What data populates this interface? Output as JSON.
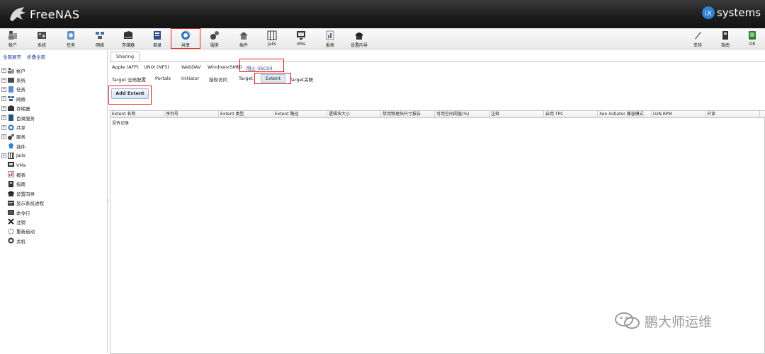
{
  "app": {
    "brand": "FreeNAS",
    "vendor": "systems",
    "vendor_prefix": "iX"
  },
  "toolbar": {
    "items": [
      {
        "label": "帐户",
        "icon": "account-icon"
      },
      {
        "label": "系统",
        "icon": "system-icon"
      },
      {
        "label": "任务",
        "icon": "tasks-icon"
      },
      {
        "label": "网络",
        "icon": "network-icon"
      },
      {
        "label": "存储器",
        "icon": "storage-icon"
      },
      {
        "label": "目录",
        "icon": "directory-icon"
      },
      {
        "label": "共享",
        "icon": "sharing-icon"
      },
      {
        "label": "服务",
        "icon": "services-icon"
      },
      {
        "label": "插件",
        "icon": "plugins-icon"
      },
      {
        "label": "Jails",
        "icon": "jails-icon"
      },
      {
        "label": "VMs",
        "icon": "vms-icon"
      },
      {
        "label": "报表",
        "icon": "reporting-icon"
      },
      {
        "label": "设置向导",
        "icon": "wizard-icon"
      }
    ],
    "right_items": [
      {
        "label": "支持",
        "icon": "support-icon"
      },
      {
        "label": "指南",
        "icon": "guide-icon"
      },
      {
        "label": "OK",
        "icon": "alert-ok-icon"
      }
    ]
  },
  "left": {
    "expand_all": "全部展开",
    "collapse_all": "折叠全部",
    "tree": [
      {
        "label": "帐户",
        "expandable": true,
        "icon": "account-icon"
      },
      {
        "label": "系统",
        "expandable": true,
        "icon": "system-icon"
      },
      {
        "label": "任务",
        "expandable": true,
        "icon": "tasks-icon"
      },
      {
        "label": "网络",
        "expandable": true,
        "icon": "network-icon"
      },
      {
        "label": "存储器",
        "expandable": true,
        "icon": "storage-icon"
      },
      {
        "label": "目录服务",
        "expandable": true,
        "icon": "directory-icon"
      },
      {
        "label": "共享",
        "expandable": true,
        "icon": "sharing-icon"
      },
      {
        "label": "服务",
        "expandable": true,
        "icon": "services-icon"
      },
      {
        "label": "插件",
        "expandable": false,
        "icon": "plugins-icon"
      },
      {
        "label": "Jails",
        "expandable": true,
        "icon": "jails-icon"
      },
      {
        "label": "VMs",
        "expandable": false,
        "icon": "vms-icon"
      },
      {
        "label": "报表",
        "expandable": false,
        "icon": "reporting-icon"
      },
      {
        "label": "指南",
        "expandable": false,
        "icon": "guide-icon"
      },
      {
        "label": "设置向导",
        "expandable": false,
        "icon": "wizard-icon"
      },
      {
        "label": "显示系统进程",
        "expandable": false,
        "icon": "processes-icon"
      },
      {
        "label": "命令行",
        "expandable": false,
        "icon": "shell-icon"
      },
      {
        "label": "注销",
        "expandable": false,
        "icon": "logout-icon"
      },
      {
        "label": "重新启动",
        "expandable": false,
        "icon": "reboot-icon"
      },
      {
        "label": "关机",
        "expandable": false,
        "icon": "shutdown-icon"
      }
    ]
  },
  "main": {
    "tab": "Sharing",
    "share_tabs": [
      "Apple (AFP)",
      "UNIX (NFS)",
      "WebDAV",
      "Windows(SMB)",
      "阻止 (iSCSI)"
    ],
    "iscsi_tabs": [
      "Target 全局配置",
      "Portals",
      "Initiator",
      "授权访问",
      "Target",
      "Extent",
      "Target关联"
    ],
    "add_button": "Add Extent",
    "columns": [
      "Extent 名称",
      "序列号",
      "Extent 类型",
      "Extent 路径",
      "逻辑块大小",
      "禁用物理块尺寸报告",
      "可用空间阈值(%)",
      "注释",
      "启用 TPC",
      "Xen Initiator 兼容模式",
      "LUN RPM",
      "只读"
    ],
    "empty_text": "没有记录"
  },
  "watermark": "鹏大师运维"
}
